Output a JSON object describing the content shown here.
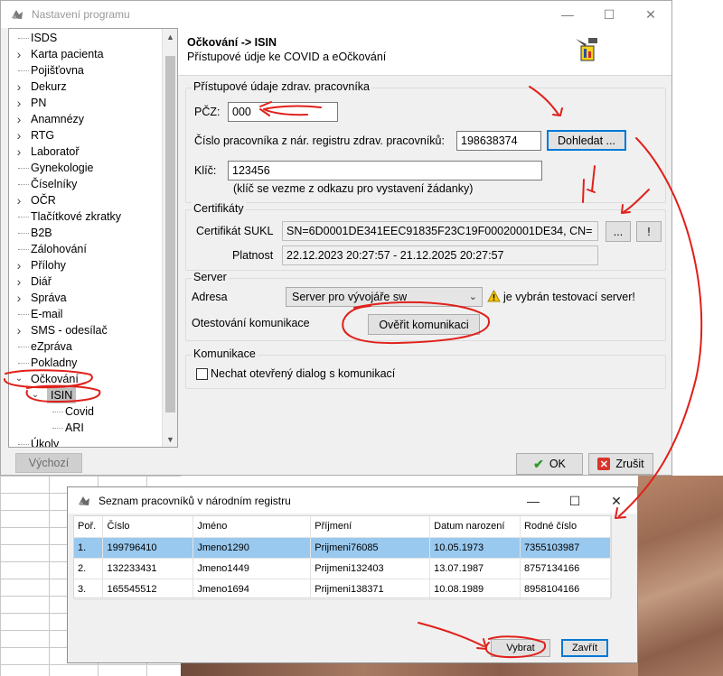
{
  "main_window": {
    "title": "Nastavení programu",
    "tree": {
      "items": [
        {
          "label": "ISDS",
          "level": 0,
          "expander": ""
        },
        {
          "label": "Karta pacienta",
          "level": 0,
          "expander": ">"
        },
        {
          "label": "Pojišťovna",
          "level": 0,
          "expander": ""
        },
        {
          "label": "Dekurz",
          "level": 0,
          "expander": ">"
        },
        {
          "label": "PN",
          "level": 0,
          "expander": ">"
        },
        {
          "label": "Anamnézy",
          "level": 0,
          "expander": ">"
        },
        {
          "label": "RTG",
          "level": 0,
          "expander": ">"
        },
        {
          "label": "Laboratoř",
          "level": 0,
          "expander": ">"
        },
        {
          "label": "Gynekologie",
          "level": 0,
          "expander": ""
        },
        {
          "label": "Číselníky",
          "level": 0,
          "expander": ""
        },
        {
          "label": "OČR",
          "level": 0,
          "expander": ">"
        },
        {
          "label": "Tlačítkové zkratky",
          "level": 0,
          "expander": ""
        },
        {
          "label": "B2B",
          "level": 0,
          "expander": ""
        },
        {
          "label": "Zálohování",
          "level": 0,
          "expander": ""
        },
        {
          "label": "Přílohy",
          "level": 0,
          "expander": ">"
        },
        {
          "label": "Diář",
          "level": 0,
          "expander": ">"
        },
        {
          "label": "Správa",
          "level": 0,
          "expander": ">"
        },
        {
          "label": "E-mail",
          "level": 0,
          "expander": ""
        },
        {
          "label": "SMS - odesílač",
          "level": 0,
          "expander": ">"
        },
        {
          "label": "eZpráva",
          "level": 0,
          "expander": ""
        },
        {
          "label": "Pokladny",
          "level": 0,
          "expander": ""
        },
        {
          "label": "Očkování",
          "level": 0,
          "expander": "v"
        },
        {
          "label": "ISIN",
          "level": 1,
          "expander": "v",
          "selected": true
        },
        {
          "label": "Covid",
          "level": 2,
          "expander": ""
        },
        {
          "label": "ARI",
          "level": 2,
          "expander": ""
        },
        {
          "label": "Úkoly",
          "level": 0,
          "expander": ""
        }
      ]
    },
    "header": {
      "title": "Očkování -> ISIN",
      "subtitle": "Přístupové údje ke COVID a eOčkování"
    },
    "access_group": {
      "title": "Přístupové údaje zdrav. pracovníka",
      "pcz_label": "PČZ:",
      "pcz_value": "000",
      "worker_label": "Číslo pracovníka z nár. registru zdrav. pracovníků:",
      "worker_value": "198638374",
      "lookup_button": "Dohledat ...",
      "key_label": "Klíč:",
      "key_value": "123456",
      "key_note": "(klíč se vezme z odkazu pro vystavení žádanky)"
    },
    "cert_group": {
      "title": "Certifikáty",
      "sukl_label": "Certifikát SUKL",
      "sukl_value": "SN=6D0001DE341EEC91835F23C19F00020001DE34, CN=",
      "browse_button": "...",
      "info_button": "!",
      "validity_label": "Platnost",
      "validity_value": "22.12.2023 20:27:57 - 21.12.2025 20:27:57"
    },
    "server_group": {
      "title": "Server",
      "address_label": "Adresa",
      "address_value": "Server pro vývojáře sw",
      "warning_text": "je vybrán testovací server!",
      "test_label": "Otestování komunikace",
      "test_button": "Ověřit komunikaci"
    },
    "comm_group": {
      "title": "Komunikace",
      "checkbox_label": "Nechat otevřený dialog s komunikací",
      "checked": false
    },
    "buttons": {
      "default": "Výchozí",
      "ok": "OK",
      "cancel": "Zrušit"
    }
  },
  "list_window": {
    "title": "Seznam pracovníků v národním registru",
    "columns": [
      "Poř.",
      "Číslo",
      "Jméno",
      "Příjmení",
      "Datum narození",
      "Rodné číslo"
    ],
    "rows": [
      {
        "no": "1.",
        "number": "199796410",
        "name": "Jmeno1290",
        "surname": "Prijmeni76085",
        "birth": "10.05.1973",
        "rc": "7355103987"
      },
      {
        "no": "2.",
        "number": "132233431",
        "name": "Jmeno1449",
        "surname": "Prijmeni132403",
        "birth": "13.07.1987",
        "rc": "8757134166"
      },
      {
        "no": "3.",
        "number": "165545512",
        "name": "Jmeno1694",
        "surname": "Prijmeni138371",
        "birth": "10.08.1989",
        "rc": "8958104166"
      }
    ],
    "selected_row": 0,
    "buttons": {
      "select": "Vybrat",
      "close": "Zavřít"
    }
  },
  "colors": {
    "annotation": "#e0201a",
    "selection": "#99c9ef",
    "focus": "#0078d7"
  }
}
